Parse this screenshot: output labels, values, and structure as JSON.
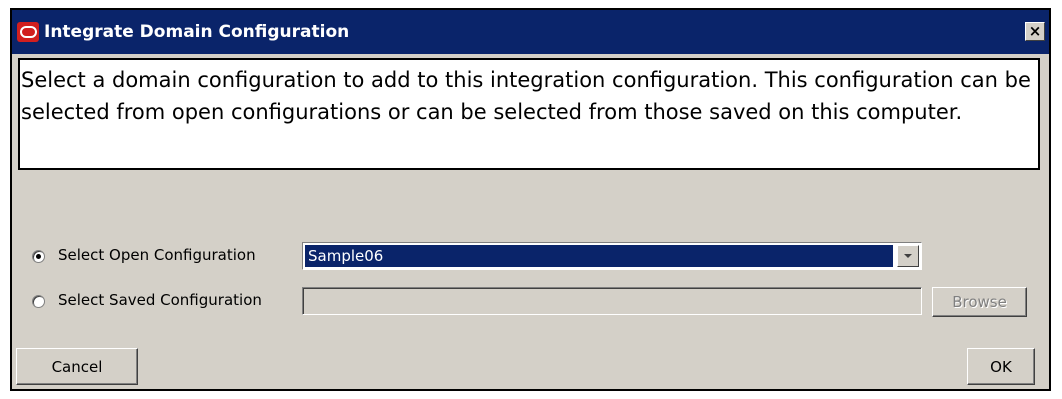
{
  "window": {
    "title": "Integrate Domain Configuration",
    "close_label": "×"
  },
  "message": "Select a domain configuration to add to this integration configuration. This configuration can be selected from open configurations or can be selected from those saved on this computer.",
  "options": {
    "open_config": {
      "label": "Select Open Configuration",
      "selected": true,
      "value": "Sample06"
    },
    "saved_config": {
      "label": "Select Saved Configuration",
      "selected": false,
      "value": "",
      "browse_label": "Browse"
    }
  },
  "buttons": {
    "cancel": "Cancel",
    "ok": "OK"
  },
  "colors": {
    "titlebar": "#0a246a",
    "dialog_bg": "#d4d0c8",
    "selection": "#0a246a",
    "app_icon": "#d11f1f"
  },
  "icons": {
    "app": "oracle-logo-icon",
    "close": "close-icon",
    "dropdown": "chevron-down-icon"
  }
}
